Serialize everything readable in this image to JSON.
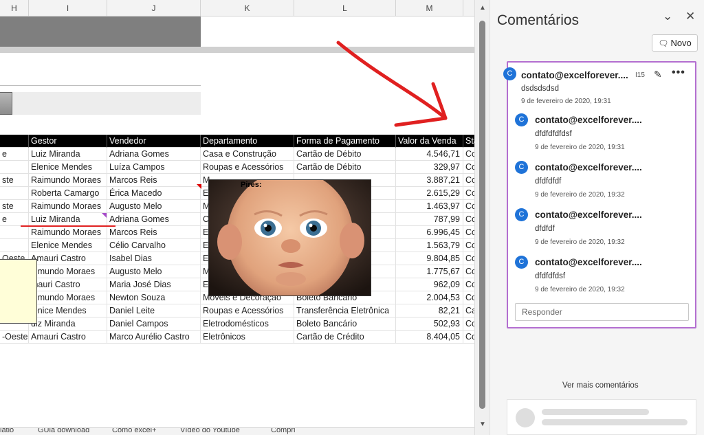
{
  "columns": [
    "H",
    "I",
    "J",
    "K",
    "L",
    "M"
  ],
  "table": {
    "headers": [
      "",
      "Gestor",
      "Vendedor",
      "Departamento",
      "Forma de Pagamento",
      "Valor da Venda",
      "Sta"
    ],
    "rows": [
      [
        "e",
        "Luiz Miranda",
        "Adriana Gomes",
        "Casa e Construção",
        "Cartão de Débito",
        "4.546,71",
        "Co"
      ],
      [
        "",
        "Elenice Mendes",
        "Luíza Campos",
        "Roupas e Acessórios",
        "Cartão de Débito",
        "329,97",
        "Co"
      ],
      [
        "ste",
        "Raimundo Moraes",
        "Marcos Reis",
        "M",
        "",
        "3.887,21",
        "Co"
      ],
      [
        "",
        "Roberta Camargo",
        "Érica Macedo",
        "El",
        "",
        "2.615,29",
        "Co"
      ],
      [
        "ste",
        "Raimundo Moraes",
        "Augusto Melo",
        "M",
        "rônica",
        "1.463,97",
        "Co"
      ],
      [
        "e",
        "Luiz Miranda",
        "Adriana Gomes",
        "C",
        "",
        "787,99",
        "Co"
      ],
      [
        "",
        "Raimundo Moraes",
        "Marcos Reis",
        "El",
        "",
        "6.996,45",
        "Co"
      ],
      [
        "",
        "Elenice Mendes",
        "Célio Carvalho",
        "E",
        "",
        "1.563,79",
        "Co"
      ],
      [
        "Oeste",
        "Amauri Castro",
        "Isabel Dias",
        "El",
        "",
        "9.804,85",
        "Co"
      ],
      [
        "",
        "aimundo Moraes",
        "Augusto Melo",
        "M",
        "",
        "1.775,67",
        "Co"
      ],
      [
        "",
        "mauri Castro",
        "Maria José Dias",
        "E",
        "",
        "962,09",
        "Co"
      ],
      [
        "",
        "aimundo Moraes",
        "Newton Souza",
        "Móveis e Decoração",
        "Boleto Bancário",
        "2.004,53",
        "Co"
      ],
      [
        "",
        "lenice Mendes",
        "Daniel Leite",
        "Roupas e Acessórios",
        "Transferência Eletrônica",
        "82,21",
        "Ca"
      ],
      [
        "",
        "uiz Miranda",
        "Daniel Campos",
        "Eletrodomésticos",
        "Boleto Bancário",
        "502,93",
        "Co"
      ],
      [
        "-Oeste",
        "Amauri Castro",
        "Marco Aurélio Castro",
        "Eletrônicos",
        "Cartão de Crédito",
        "8.404,05",
        "Co"
      ]
    ]
  },
  "image_comment": {
    "author": "Pires:"
  },
  "sheet_tabs": [
    "látio",
    "GUia download",
    "Como excel+",
    "Vídeo do Youtube",
    "Comprl"
  ],
  "pane": {
    "title": "Comentários",
    "new_button": "Novo",
    "thread": {
      "cell_ref": "I15",
      "avatar_letter": "C",
      "main": {
        "author": "contato@excelforever....",
        "text": "dsdsdsdsd",
        "date": "9 de fevereiro de 2020, 19:31"
      },
      "replies": [
        {
          "author": "contato@excelforever....",
          "text": "dfdfdfdfdsf",
          "date": "9 de fevereiro de 2020, 19:31"
        },
        {
          "author": "contato@excelforever....",
          "text": "dfdfdfdf",
          "date": "9 de fevereiro de 2020, 19:32"
        },
        {
          "author": "contato@excelforever....",
          "text": "dfdfdf",
          "date": "9 de fevereiro de 2020, 19:32"
        },
        {
          "author": "contato@excelforever....",
          "text": "dfdfdfdsf",
          "date": "9 de fevereiro de 2020, 19:32"
        }
      ],
      "reply_placeholder": "Responder"
    },
    "see_more": "Ver mais comentários"
  },
  "colors": {
    "accent_purple": "#b36ed0",
    "avatar_blue": "#1f73d8",
    "arrow_red": "#e02020"
  },
  "icons": [
    "chevron-down-icon",
    "close-icon",
    "new-comment-icon",
    "edit-icon",
    "more-icon",
    "scroll-up-icon",
    "scroll-down-icon"
  ]
}
